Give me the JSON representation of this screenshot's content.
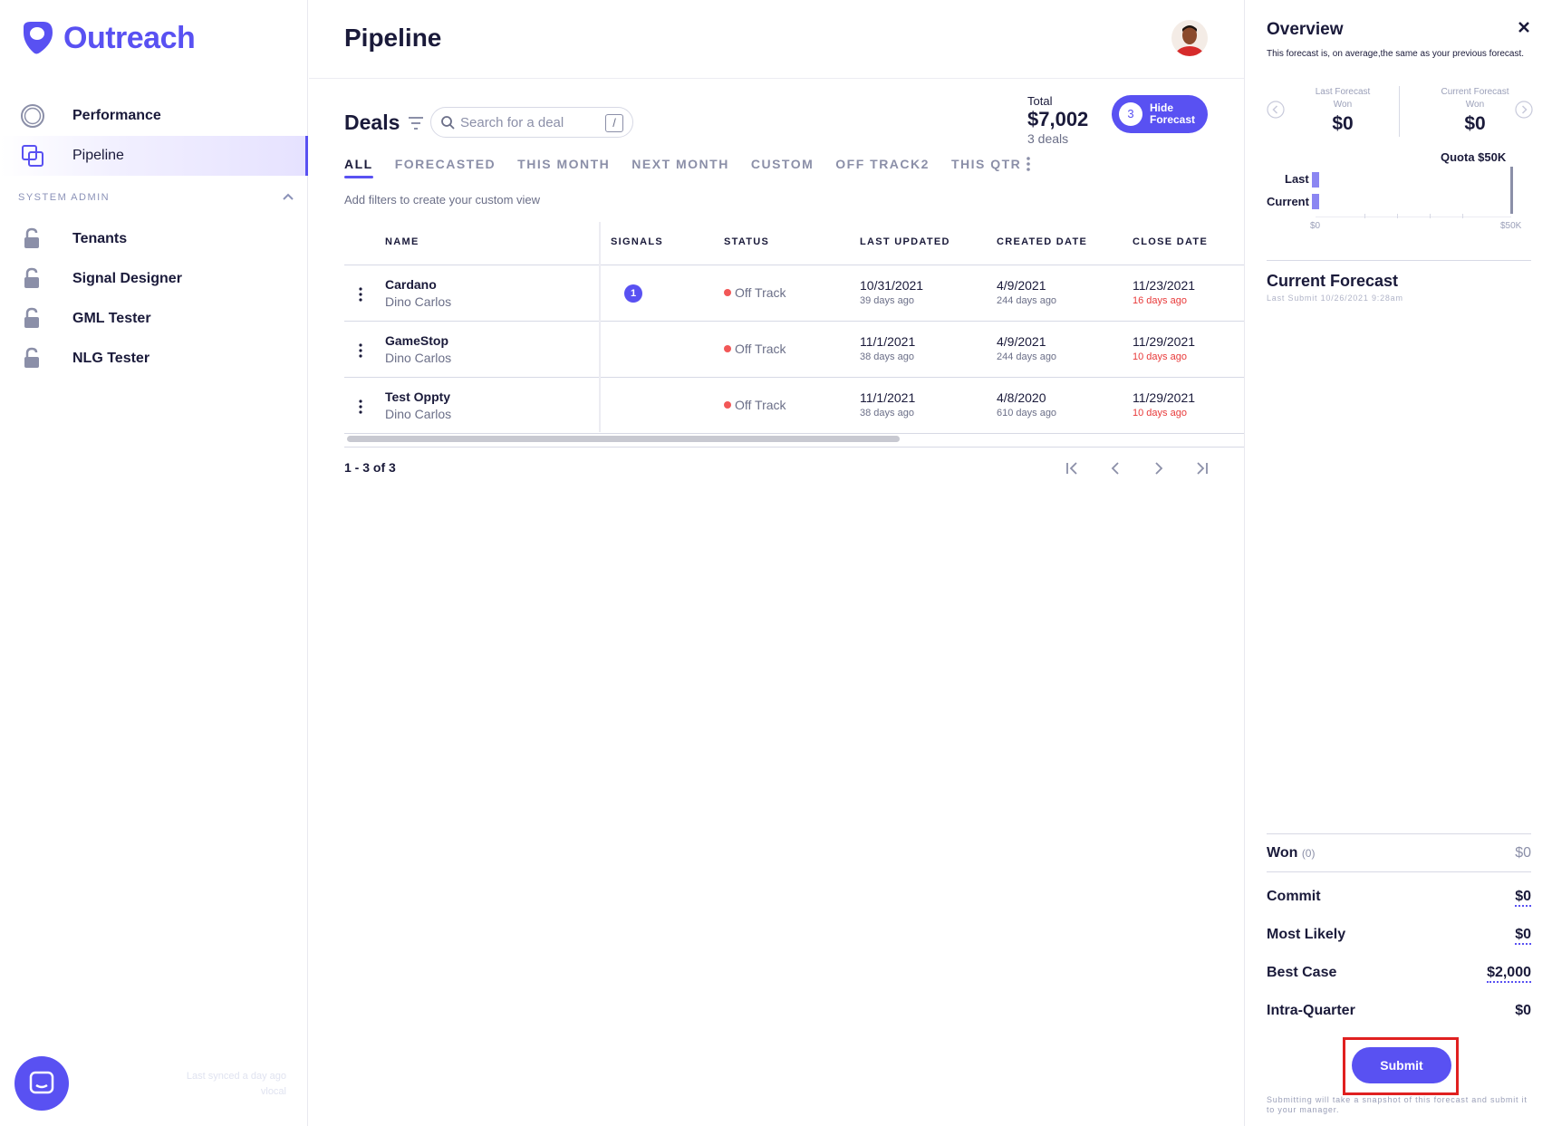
{
  "brand": {
    "name": "Outreach",
    "color": "#5951f2"
  },
  "sidebar": {
    "items": [
      {
        "label": "Performance",
        "icon": "circle-outline-icon"
      },
      {
        "label": "Pipeline",
        "icon": "layers-icon",
        "active": true
      }
    ],
    "section_title": "SYSTEM ADMIN",
    "admin_items": [
      {
        "label": "Tenants",
        "icon": "unlock-icon"
      },
      {
        "label": "Signal Designer",
        "icon": "unlock-icon"
      },
      {
        "label": "GML Tester",
        "icon": "unlock-icon"
      },
      {
        "label": "NLG Tester",
        "icon": "unlock-icon"
      }
    ],
    "sync_line1": "Last synced a day ago",
    "sync_line2": "vlocal"
  },
  "header": {
    "title": "Pipeline"
  },
  "deals": {
    "title": "Deals",
    "search_placeholder": "Search for a deal",
    "search_shortcut": "/",
    "total_label": "Total",
    "total_value": "$7,002",
    "total_count": "3 deals",
    "forecast_count": "3",
    "forecast_button": "Hide Forecast",
    "tabs": [
      "ALL",
      "FORECASTED",
      "THIS MONTH",
      "NEXT MONTH",
      "CUSTOM",
      "OFF TRACK2",
      "THIS QTR"
    ],
    "active_tab": "ALL",
    "filter_hint": "Add filters to create your custom view",
    "columns": [
      "NAME",
      "SIGNALS",
      "STATUS",
      "LAST UPDATED",
      "CREATED DATE",
      "CLOSE DATE"
    ],
    "rows": [
      {
        "name": "Cardano",
        "owner": "Dino Carlos",
        "signals": "1",
        "status": "Off Track",
        "last_updated": "10/31/2021",
        "last_updated_ago": "39 days ago",
        "created": "4/9/2021",
        "created_ago": "244 days ago",
        "close": "11/23/2021",
        "close_ago": "16 days ago"
      },
      {
        "name": "GameStop",
        "owner": "Dino Carlos",
        "signals": "",
        "status": "Off Track",
        "last_updated": "11/1/2021",
        "last_updated_ago": "38 days ago",
        "created": "4/9/2021",
        "created_ago": "244 days ago",
        "close": "11/29/2021",
        "close_ago": "10 days ago"
      },
      {
        "name": "Test Oppty",
        "owner": "Dino Carlos",
        "signals": "",
        "status": "Off Track",
        "last_updated": "11/1/2021",
        "last_updated_ago": "38 days ago",
        "created": "4/8/2020",
        "created_ago": "610 days ago",
        "close": "11/29/2021",
        "close_ago": "10 days ago"
      }
    ],
    "range_text": "1 - 3 of 3"
  },
  "overview": {
    "title": "Overview",
    "description": "This forecast is, on average,the same as your previous forecast.",
    "last_forecast_label": "Last Forecast",
    "current_forecast_label": "Current Forecast",
    "won_label": "Won",
    "last_won": "$0",
    "current_won": "$0",
    "quota": "Quota $50K",
    "bar_last": "Last",
    "bar_current": "Current",
    "axis_min": "$0",
    "axis_max": "$50K",
    "current_forecast_title": "Current Forecast",
    "last_submit": "Last Submit 10/26/2021 9:28am",
    "won_row_label": "Won",
    "won_row_count": "(0)",
    "won_row_value": "$0",
    "lines": [
      {
        "label": "Commit",
        "value": "$0"
      },
      {
        "label": "Most Likely",
        "value": "$0"
      },
      {
        "label": "Best Case",
        "value": "$2,000"
      },
      {
        "label": "Intra-Quarter",
        "value": "$0"
      }
    ],
    "submit_label": "Submit",
    "footer": "Submitting will take a snapshot of this forecast and submit it to your manager."
  }
}
